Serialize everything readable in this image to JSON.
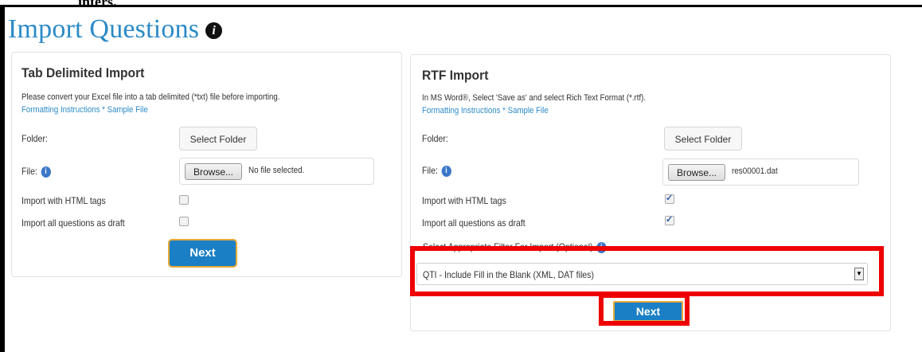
{
  "top_snippet": "inters.",
  "page": {
    "title": "Import Questions",
    "title_icon": "info-icon"
  },
  "tab_panel": {
    "title": "Tab Delimited Import",
    "description": "Please convert your Excel file into a tab delimited (*txt) file before importing.",
    "formatting_link": "Formatting Instructions",
    "separator": " * ",
    "sample_link": "Sample File",
    "folder_label": "Folder:",
    "select_folder_label": "Select Folder",
    "file_label": "File:",
    "browse_label": "Browse...",
    "file_value": "No file selected.",
    "html_tags_label": "Import with HTML tags",
    "html_tags_checked": false,
    "draft_label": "Import all questions as draft",
    "draft_checked": false,
    "next_label": "Next"
  },
  "rtf_panel": {
    "title": "RTF Import",
    "description": "In MS Word®, Select 'Save as' and select Rich Text Format (*.rtf).",
    "formatting_link": "Formatting Instructions",
    "separator": " * ",
    "sample_link": "Sample File",
    "folder_label": "Folder:",
    "select_folder_label": "Select Folder",
    "file_label": "File:",
    "browse_label": "Browse...",
    "file_value": "res00001.dat",
    "html_tags_label": "Import with HTML tags",
    "html_tags_checked": true,
    "draft_label": "Import all questions as draft",
    "draft_checked": true,
    "filter_label": "Select Appropriate Filter For Import (Optional)",
    "filter_selected": "QTI - Include Fill in the Blank (XML, DAT files)",
    "next_label": "Next"
  },
  "colors": {
    "accent": "#2b8ac6",
    "button": "#1a7fc4",
    "highlight": "#ee0000"
  }
}
